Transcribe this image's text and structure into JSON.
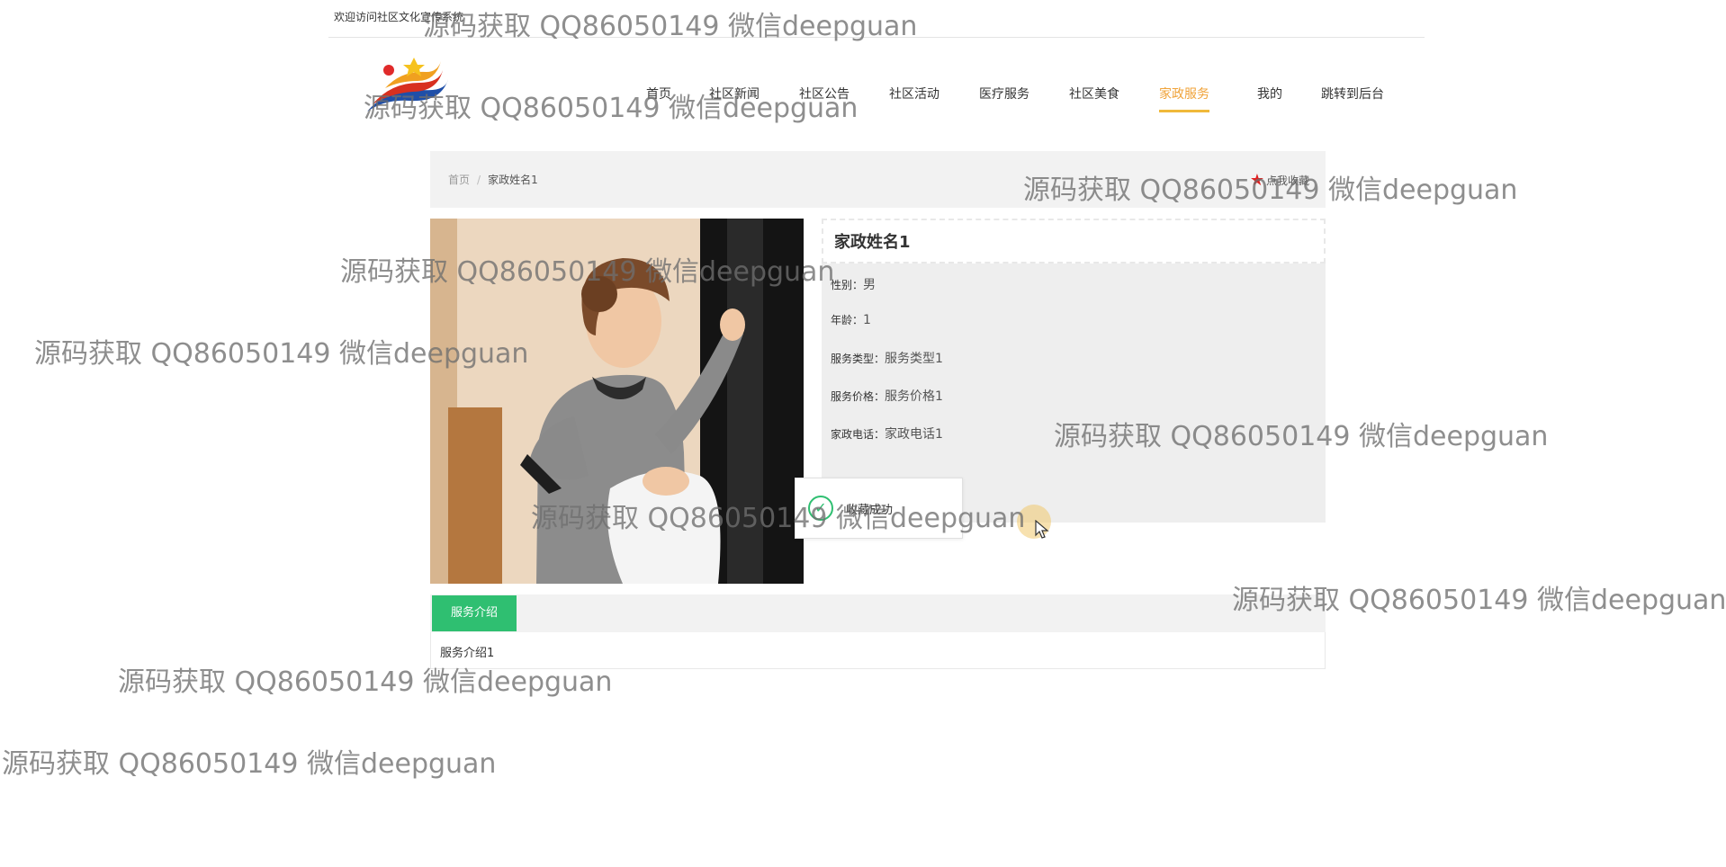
{
  "header": {
    "welcome": "欢迎访问社区文化宣传系统"
  },
  "nav": {
    "items": [
      "首页",
      "社区新闻",
      "社区公告",
      "社区活动",
      "医疗服务",
      "社区美食",
      "家政服务",
      "我的",
      "跳转到后台"
    ],
    "active_index": 6,
    "active_color": "#f0a33a"
  },
  "breadcrumb": {
    "home": "首页",
    "separator": "/",
    "current": "家政姓名1"
  },
  "favorite": {
    "label": "点我收藏"
  },
  "detail": {
    "title": "家政姓名1",
    "fields": [
      {
        "key": "性别：",
        "value": "男"
      },
      {
        "key": "年龄：",
        "value": "1"
      },
      {
        "key": "服务类型：",
        "value": "服务类型1"
      },
      {
        "key": "服务价格：",
        "value": "服务价格1"
      },
      {
        "key": "家政电话：",
        "value": "家政电话1"
      }
    ]
  },
  "toast": {
    "message": "收藏成功",
    "icon": "check-circle-icon",
    "color": "#2fbf71"
  },
  "tabs": {
    "active_label": "服务介绍",
    "content": "服务介绍1",
    "accent": "#2fbf71"
  },
  "watermark": {
    "text": "源码获取 QQ86050149 微信deepguan"
  }
}
